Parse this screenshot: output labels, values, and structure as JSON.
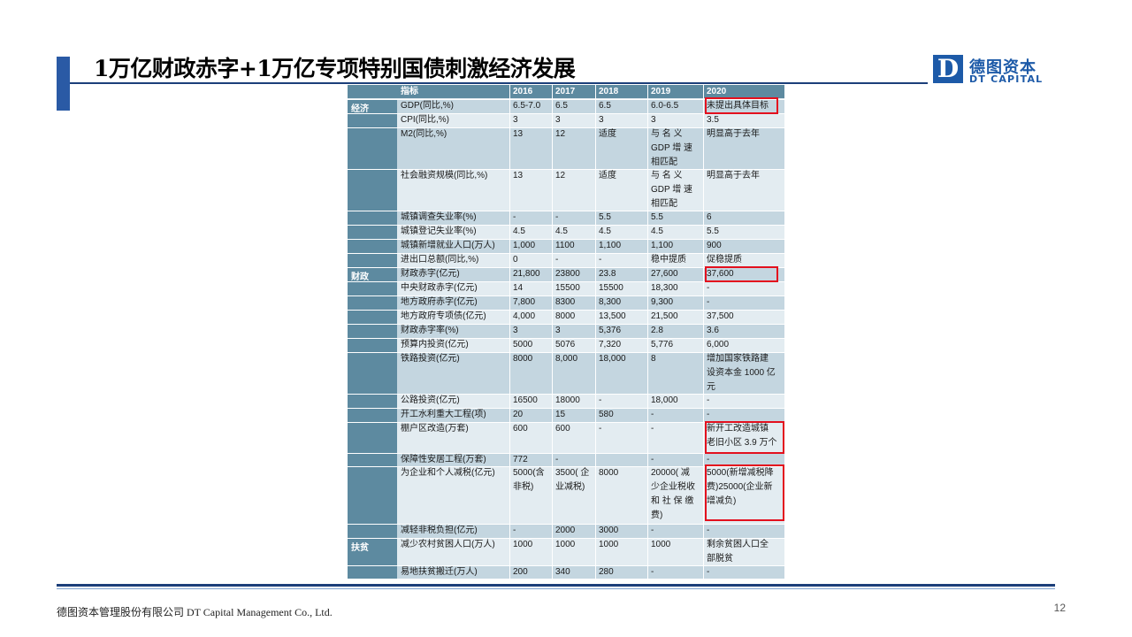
{
  "slide": {
    "title": "1万亿财政赤字+1万亿专项特别国债刺激经济发展",
    "page_number": "12",
    "footer": "德图资本管理股份有限公司  DT Capital Management Co., Ltd."
  },
  "logo": {
    "mark": "D",
    "name_cn": "德图资本",
    "name_en": "DT CAPITAL"
  },
  "table": {
    "headers": [
      "指标",
      "2016",
      "2017",
      "2018",
      "2019",
      "2020"
    ],
    "categories": [
      "经济",
      "财政",
      "扶贫"
    ],
    "rows": [
      {
        "label": "GDP(同比,%)",
        "v": [
          "6.5-7.0",
          "6.5",
          "6.5",
          "6.0-6.5",
          "未提出具体目标"
        ]
      },
      {
        "label": "CPI(同比,%)",
        "v": [
          "3",
          "3",
          "3",
          "3",
          "3.5"
        ]
      },
      {
        "label": "M2(同比,%)",
        "v": [
          "13",
          "12",
          "适度",
          "与  名  义\nGDP  增 速\n相匹配",
          "明显高于去年"
        ]
      },
      {
        "label": "社会融资规模(同比,%)",
        "v": [
          "13",
          "12",
          "适度",
          "与  名  义\nGDP  增 速\n相匹配",
          "明显高于去年"
        ]
      },
      {
        "label": "城镇调查失业率(%)",
        "v": [
          "-",
          "-",
          "5.5",
          "5.5",
          "6"
        ]
      },
      {
        "label": "城镇登记失业率(%)",
        "v": [
          "4.5",
          "4.5",
          "4.5",
          "4.5",
          "5.5"
        ]
      },
      {
        "label": "城镇新增就业人口(万人)",
        "v": [
          "1,000",
          "1100",
          "1,100",
          "1,100",
          "900"
        ]
      },
      {
        "label": "进出口总额(同比,%)",
        "v": [
          "0",
          "-",
          "-",
          "稳中提质",
          "促稳提质"
        ]
      },
      {
        "label": "财政赤字(亿元)",
        "v": [
          "21,800",
          "23800",
          "23.8",
          "27,600",
          "37,600"
        ]
      },
      {
        "label": "中央财政赤字(亿元)",
        "v": [
          "14",
          "15500",
          "15500",
          "18,300",
          "-"
        ]
      },
      {
        "label": "地方政府赤字(亿元)",
        "v": [
          "7,800",
          "8300",
          "8,300",
          "9,300",
          "-"
        ]
      },
      {
        "label": "地方政府专项债(亿元)",
        "v": [
          "4,000",
          "8000",
          "13,500",
          "21,500",
          "37,500"
        ]
      },
      {
        "label": "财政赤字率(%)",
        "v": [
          "3",
          "3",
          "5,376",
          "2.8",
          "3.6"
        ]
      },
      {
        "label": "预算内投资(亿元)",
        "v": [
          "5000",
          "5076",
          "7,320",
          "5,776",
          "6,000"
        ]
      },
      {
        "label": "铁路投资(亿元)",
        "v": [
          "8000",
          "8,000",
          "18,000",
          "8",
          "增加国家铁路建\n设资本金 1000 亿\n元"
        ]
      },
      {
        "label": "公路投资(亿元)",
        "v": [
          "16500",
          "18000",
          "-",
          "18,000",
          "-"
        ]
      },
      {
        "label": "开工水利重大工程(项)",
        "v": [
          "20",
          "15",
          "580",
          "-",
          "-"
        ]
      },
      {
        "label": "棚户区改造(万套)",
        "v": [
          "600",
          "600",
          "-",
          "-",
          "新开工改造城镇\n老旧小区 3.9 万个"
        ]
      },
      {
        "label": "保障性安居工程(万套)",
        "v": [
          "772",
          "-",
          "",
          "-",
          "-"
        ]
      },
      {
        "label": "为企业和个人减税(亿元)",
        "v": [
          "5000(含\n非税)",
          "3500( 企\n业减税)",
          "8000",
          "20000(  减\n少企业税收\n和 社 保 缴\n费)",
          "5000(新增减税降\n费)25000(企业新\n增减负)"
        ]
      },
      {
        "label": "减轻非税负担(亿元)",
        "v": [
          "-",
          "2000",
          "3000",
          "-",
          "-"
        ]
      },
      {
        "label": "减少农村贫困人口(万人)",
        "v": [
          "1000",
          "1000",
          "1000",
          "1000",
          "剩余贫困人口全\n部脱贫"
        ]
      },
      {
        "label": "易地扶贫搬迁(万人)",
        "v": [
          "200",
          "340",
          "280",
          "-",
          "-"
        ]
      }
    ]
  }
}
